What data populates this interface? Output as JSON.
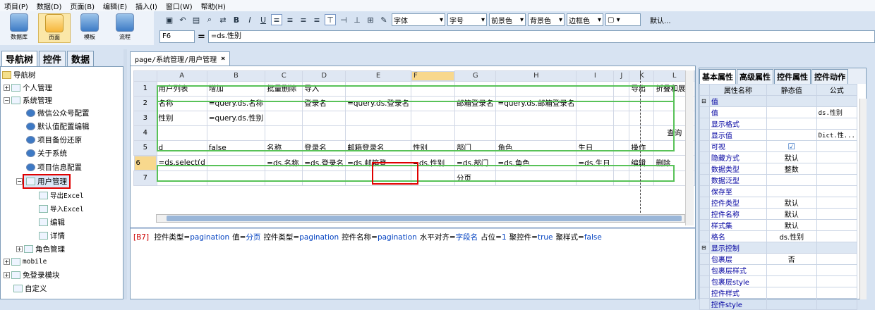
{
  "menu": [
    "项目(P)",
    "数据(D)",
    "页面(B)",
    "编辑(E)",
    "插入(I)",
    "窗口(W)",
    "帮助(H)"
  ],
  "big_buttons": [
    {
      "label": "数据库"
    },
    {
      "label": "页面"
    },
    {
      "label": "模板"
    },
    {
      "label": "流程"
    }
  ],
  "toolbar": {
    "font": "字体",
    "size": "字号",
    "fg": "前景色",
    "bg": "背景色",
    "border": "边框色",
    "default": "默认..."
  },
  "formula": {
    "cell": "F6",
    "eq": "=",
    "value": "=ds.性别"
  },
  "left_tabs": [
    "导航树",
    "控件",
    "数据"
  ],
  "tree": {
    "root": "导航树",
    "items": [
      "个人管理",
      "系统管理",
      "微信公众号配置",
      "默认值配置编辑",
      "项目备份还原",
      "关于系统",
      "项目信息配置",
      "用户管理",
      "导出Excel",
      "导入Excel",
      "编辑",
      "详情",
      "角色管理",
      "mobile",
      "免登录模块",
      "自定义"
    ]
  },
  "doc_tab": {
    "title": "page/系统管理/用户管理",
    "close": "×"
  },
  "sheet": {
    "columns": [
      "A",
      "B",
      "C",
      "D",
      "E",
      "F",
      "G",
      "H",
      "I",
      "J",
      "K",
      "L"
    ],
    "rows": [
      {
        "n": "1",
        "cells": [
          "用户列表",
          "增加",
          "批量删除",
          "导入",
          "",
          "",
          "",
          "",
          "",
          "",
          "导出",
          "折叠和展开"
        ]
      },
      {
        "n": "2",
        "cells": [
          "名称",
          "=query.ds.名称",
          "",
          "登录名",
          "=query.ds.登录名",
          "",
          "邮箱登录名",
          "=query.ds.邮箱登录名",
          "",
          "",
          "",
          ""
        ]
      },
      {
        "n": "3",
        "cells": [
          "性别",
          "=query.ds.性别",
          "",
          "",
          "",
          "",
          "",
          "",
          "",
          "",
          "",
          ""
        ]
      },
      {
        "n": "4",
        "cells": [
          "",
          "",
          "",
          "",
          "",
          "",
          "",
          "",
          "",
          "",
          "",
          "查询"
        ]
      },
      {
        "n": "5",
        "cells": [
          "d",
          "false",
          "名称",
          "登录名",
          "邮箱登录名",
          "性别",
          "部门",
          "角色",
          "生日",
          "",
          "操作",
          ""
        ]
      },
      {
        "n": "6",
        "cells": [
          "=ds.select(d",
          "",
          "=ds.名称",
          "=ds.登录名",
          "=ds.邮箱登",
          "=ds.性别",
          "=ds.部门",
          "=ds.角色",
          "=ds.生日",
          "",
          "编辑",
          "删除"
        ]
      },
      {
        "n": "7",
        "cells": [
          "",
          "",
          "",
          "",
          "",
          "",
          "分页",
          "",
          "",
          "",
          "",
          ""
        ]
      }
    ]
  },
  "status": {
    "ref": "[B7]",
    "parts": [
      {
        "k": "控件类型=",
        "v": "pagination"
      },
      {
        "k": "值=",
        "v": "分页"
      },
      {
        "k": "控件类型=",
        "v": "pagination"
      },
      {
        "k": "控件名称=",
        "v": "pagination"
      },
      {
        "k": "水平对齐=",
        "v": "字段名"
      },
      {
        "k": "占位=",
        "v": "1"
      },
      {
        "k": "聚控件=",
        "v": "true"
      },
      {
        "k": "聚样式=",
        "v": "false"
      }
    ]
  },
  "right_tabs": [
    "基本属性",
    "高级属性",
    "控件属性",
    "控件动作"
  ],
  "props_header": [
    "属性名称",
    "静态值",
    "公式"
  ],
  "props": [
    {
      "name": "值",
      "s": "",
      "f": "",
      "grp": true
    },
    {
      "name": "值",
      "s": "",
      "f": "ds.性别"
    },
    {
      "name": "显示格式",
      "s": "",
      "f": ""
    },
    {
      "name": "显示值",
      "s": "",
      "f": "Dict.性..."
    },
    {
      "name": "可视",
      "s": "☑",
      "f": ""
    },
    {
      "name": "隐藏方式",
      "s": "默认",
      "f": ""
    },
    {
      "name": "数据类型",
      "s": "整数",
      "f": ""
    },
    {
      "name": "数据泛型",
      "s": "",
      "f": ""
    },
    {
      "name": "保存至",
      "s": "",
      "f": ""
    },
    {
      "name": "控件类型",
      "s": "默认",
      "f": ""
    },
    {
      "name": "控件名称",
      "s": "默认",
      "f": ""
    },
    {
      "name": "样式集",
      "s": "默认",
      "f": ""
    },
    {
      "name": "格名",
      "s": "ds.性别",
      "f": ""
    },
    {
      "name": "显示控制",
      "s": "",
      "f": "",
      "grp": true
    },
    {
      "name": "包裹层",
      "s": "否",
      "f": ""
    },
    {
      "name": "包裹层样式",
      "s": "",
      "f": ""
    },
    {
      "name": "包裹层style",
      "s": "",
      "f": ""
    },
    {
      "name": "控件样式",
      "s": "",
      "f": ""
    },
    {
      "name": "控件style",
      "s": "",
      "f": ""
    }
  ]
}
